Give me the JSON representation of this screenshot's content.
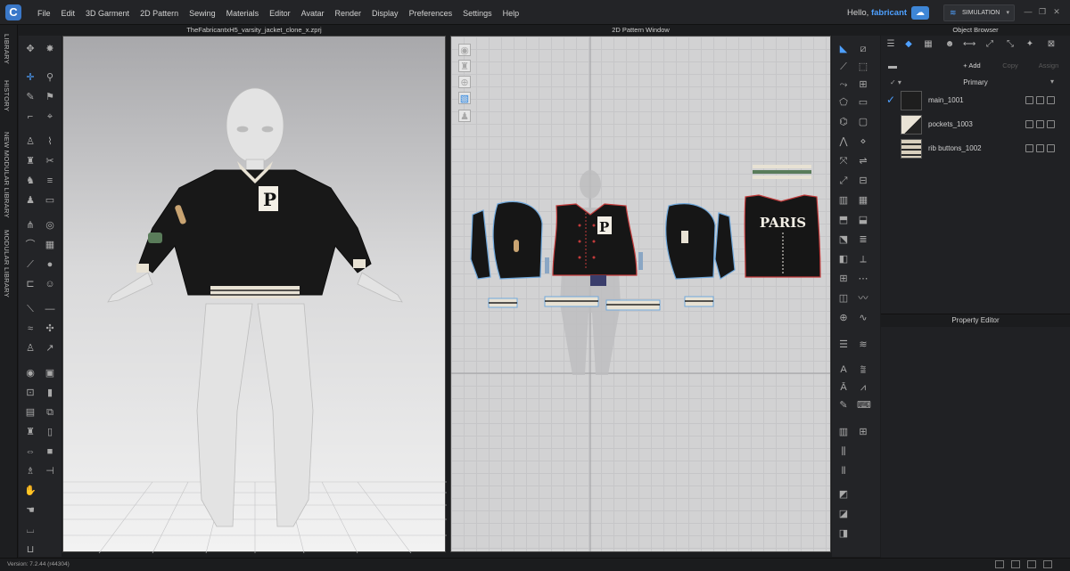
{
  "menubar": {
    "logo": "C",
    "items": [
      "File",
      "Edit",
      "3D Garment",
      "2D Pattern",
      "Sewing",
      "Materials",
      "Editor",
      "Avatar",
      "Render",
      "Display",
      "Preferences",
      "Settings",
      "Help"
    ],
    "greeting": "Hello,",
    "username": "fabricant",
    "sim_label": "SIMULATION",
    "window_controls": [
      "—",
      "❐",
      "✕"
    ]
  },
  "side_tabs": [
    "LIBRARY",
    "HISTORY",
    "NEW MODULAR LIBRARY",
    "MODULAR LIBRARY"
  ],
  "viewport3d": {
    "title": "TheFabricantxH5_varsity_jacket_clone_x.zprj"
  },
  "pattern": {
    "title": "2D Pattern Window",
    "piece_text": "PARIS",
    "letter": "P"
  },
  "object_browser": {
    "title": "Object Browser",
    "add_label": "+ Add",
    "copy_label": "Copy",
    "assign_label": "Assign",
    "group_label": "Primary",
    "fabrics": [
      {
        "name": "main_1001",
        "color": "#1e1e1e",
        "checked": true
      },
      {
        "name": "pockets_1003",
        "color": "#e9e3d6",
        "checked": false
      },
      {
        "name": "rib buttons_1002",
        "color": "#d8cfbd",
        "checked": false
      }
    ]
  },
  "property_editor": {
    "title": "Property Editor"
  },
  "status": {
    "version": "Version: 7.2.44 (r44304)"
  },
  "colors": {
    "accent": "#4ea0ff",
    "jacket": "#161616",
    "rib": "#e8e2d4",
    "outline": "#6fa8dc"
  }
}
